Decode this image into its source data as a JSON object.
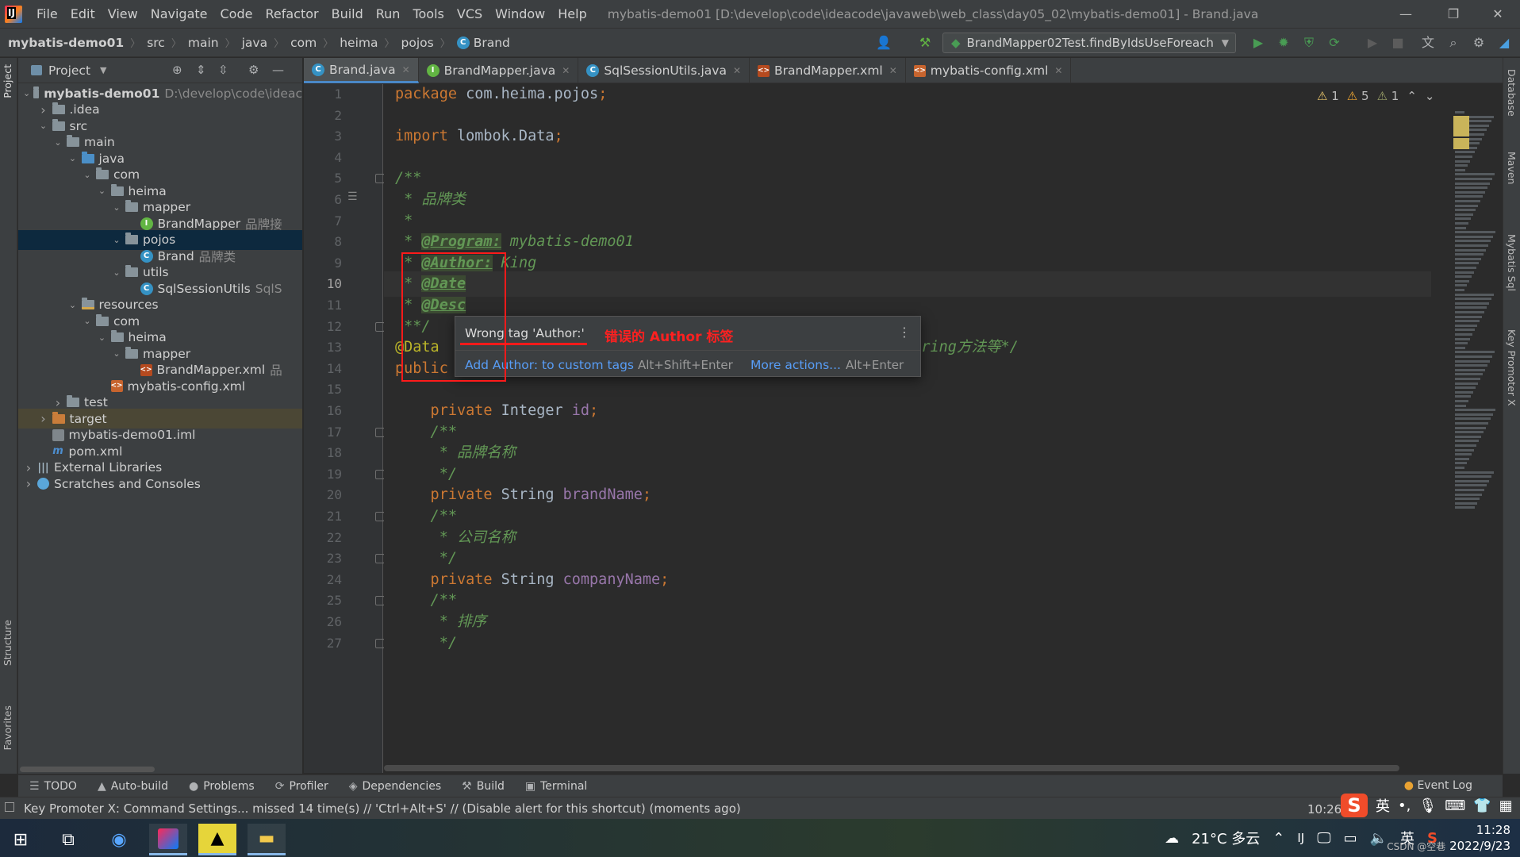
{
  "window": {
    "title": "mybatis-demo01 [D:\\develop\\code\\ideacode\\javaweb\\web_class\\day05_02\\mybatis-demo01] - Brand.java",
    "minimize": "—",
    "maximize": "❐",
    "close": "✕"
  },
  "menu": [
    "File",
    "Edit",
    "View",
    "Navigate",
    "Code",
    "Refactor",
    "Build",
    "Run",
    "Tools",
    "VCS",
    "Window",
    "Help"
  ],
  "breadcrumbs": [
    "mybatis-demo01",
    "src",
    "main",
    "java",
    "com",
    "heima",
    "pojos",
    "Brand"
  ],
  "run_config": "BrandMapper02Test.findByIdsUseForeach",
  "left_strip": {
    "project": "Project",
    "structure": "Structure",
    "favorites": "Favorites"
  },
  "right_strip": {
    "database": "Database",
    "maven": "Maven",
    "mybatis": "Mybatis Sql",
    "key_promoter": "Key Promoter X"
  },
  "project": {
    "header": "Project",
    "tree": [
      {
        "label": "mybatis-demo01",
        "hint": "D:\\develop\\code\\ideac",
        "icon": "module",
        "depth": 0,
        "open": true,
        "bold": true
      },
      {
        "label": ".idea",
        "icon": "folder",
        "depth": 1,
        "open": false
      },
      {
        "label": "src",
        "icon": "folder",
        "depth": 1,
        "open": true
      },
      {
        "label": "main",
        "icon": "folder",
        "depth": 2,
        "open": true
      },
      {
        "label": "java",
        "icon": "folder-blue",
        "depth": 3,
        "open": true
      },
      {
        "label": "com",
        "icon": "package",
        "depth": 4,
        "open": true
      },
      {
        "label": "heima",
        "icon": "package",
        "depth": 5,
        "open": true
      },
      {
        "label": "mapper",
        "icon": "package",
        "depth": 6,
        "open": true
      },
      {
        "label": "BrandMapper",
        "hint": "品牌接",
        "icon": "interface",
        "depth": 7
      },
      {
        "label": "pojos",
        "icon": "package",
        "depth": 6,
        "open": true,
        "selected": true
      },
      {
        "label": "Brand",
        "hint": "品牌类",
        "icon": "class",
        "depth": 7
      },
      {
        "label": "utils",
        "icon": "package",
        "depth": 6,
        "open": true
      },
      {
        "label": "SqlSessionUtils",
        "hint": "SqlS",
        "icon": "class",
        "depth": 7
      },
      {
        "label": "resources",
        "icon": "folder-res",
        "depth": 3,
        "open": true
      },
      {
        "label": "com",
        "icon": "folder",
        "depth": 4,
        "open": true
      },
      {
        "label": "heima",
        "icon": "folder",
        "depth": 5,
        "open": true
      },
      {
        "label": "mapper",
        "icon": "folder",
        "depth": 6,
        "open": true
      },
      {
        "label": "BrandMapper.xml",
        "hint": "品",
        "icon": "xml",
        "depth": 7
      },
      {
        "label": "mybatis-config.xml",
        "icon": "config",
        "depth": 5
      },
      {
        "label": "test",
        "icon": "folder",
        "depth": 2,
        "open": false
      },
      {
        "label": "target",
        "icon": "folder-orange",
        "depth": 1,
        "open": false,
        "excluded": true
      },
      {
        "label": "mybatis-demo01.iml",
        "icon": "iml",
        "depth": 1
      },
      {
        "label": "pom.xml",
        "icon": "maven",
        "depth": 1
      },
      {
        "label": "External Libraries",
        "icon": "library",
        "depth": 0,
        "open": false
      },
      {
        "label": "Scratches and Consoles",
        "icon": "scratch",
        "depth": 0,
        "open": false
      }
    ]
  },
  "tabs": [
    {
      "label": "Brand.java",
      "icon": "class",
      "active": true
    },
    {
      "label": "BrandMapper.java",
      "icon": "interface"
    },
    {
      "label": "SqlSessionUtils.java",
      "icon": "class"
    },
    {
      "label": "BrandMapper.xml",
      "icon": "xml"
    },
    {
      "label": "mybatis-config.xml",
      "icon": "config"
    }
  ],
  "inspections": {
    "weak_warnings": "1",
    "warnings": "5",
    "typos": "1"
  },
  "current_line": 10,
  "code": [
    [
      {
        "t": "package ",
        "c": "kw"
      },
      {
        "t": "com.heima.pojos",
        "c": ""
      },
      {
        "t": ";",
        "c": "kw"
      }
    ],
    [],
    [
      {
        "t": "import ",
        "c": "kw"
      },
      {
        "t": "lombok.Data",
        "c": ""
      },
      {
        "t": ";",
        "c": "kw"
      }
    ],
    [],
    [
      {
        "t": "/**",
        "c": "doc"
      }
    ],
    [
      {
        "t": " * 品牌类",
        "c": "doc"
      }
    ],
    [
      {
        "t": " *",
        "c": "doc"
      }
    ],
    [
      {
        "t": " * ",
        "c": "doc"
      },
      {
        "t": "@Program:",
        "c": "tag"
      },
      {
        "t": " mybatis-demo01",
        "c": "doc"
      }
    ],
    [
      {
        "t": " * ",
        "c": "doc"
      },
      {
        "t": "@Author:",
        "c": "tag"
      },
      {
        "t": " King",
        "c": "doc"
      }
    ],
    [
      {
        "t": " * ",
        "c": "doc"
      },
      {
        "t": "@Date",
        "c": "tag"
      }
    ],
    [
      {
        "t": " * ",
        "c": "doc"
      },
      {
        "t": "@Desc",
        "c": "tag"
      }
    ],
    [
      {
        "t": " **/",
        "c": "doc"
      }
    ],
    [
      {
        "t": "@Data",
        "c": "ann"
      },
      {
        "t": "   ",
        "c": ""
      },
      {
        "t": "/**",
        "c": "doc cmt-hl"
      },
      {
        "t": "能够帮助我们自动生成getter/setter方法，无参构造器，toString方法等*/",
        "c": "doc"
      }
    ],
    [
      {
        "t": "public class ",
        "c": "kw"
      },
      {
        "t": "Brand",
        "c": ""
      },
      {
        "t": " {",
        "c": ""
      }
    ],
    [],
    [
      {
        "t": "    private ",
        "c": "kw"
      },
      {
        "t": "Integer ",
        "c": ""
      },
      {
        "t": "id",
        "c": "field"
      },
      {
        "t": ";",
        "c": "kw"
      }
    ],
    [
      {
        "t": "    /**",
        "c": "doc"
      }
    ],
    [
      {
        "t": "     * 品牌名称",
        "c": "doc"
      }
    ],
    [
      {
        "t": "     */",
        "c": "doc"
      }
    ],
    [
      {
        "t": "    private ",
        "c": "kw"
      },
      {
        "t": "String ",
        "c": ""
      },
      {
        "t": "brandName",
        "c": "field"
      },
      {
        "t": ";",
        "c": "kw"
      }
    ],
    [
      {
        "t": "    /**",
        "c": "doc"
      }
    ],
    [
      {
        "t": "     * 公司名称",
        "c": "doc"
      }
    ],
    [
      {
        "t": "     */",
        "c": "doc"
      }
    ],
    [
      {
        "t": "    private ",
        "c": "kw"
      },
      {
        "t": "String ",
        "c": ""
      },
      {
        "t": "companyName",
        "c": "field"
      },
      {
        "t": ";",
        "c": "kw"
      }
    ],
    [
      {
        "t": "    /**",
        "c": "doc"
      }
    ],
    [
      {
        "t": "     * 排序",
        "c": "doc"
      }
    ],
    [
      {
        "t": "     */",
        "c": "doc"
      }
    ]
  ],
  "popup": {
    "message": "Wrong tag 'Author:'",
    "action": "Add Author: to custom tags",
    "action_key": "Alt+Shift+Enter",
    "more": "More actions...",
    "more_key": "Alt+Enter",
    "menu": "⋮"
  },
  "annotation_note": "错误的 Author 标签",
  "bottom_tools": [
    {
      "icon": "☰",
      "label": "TODO"
    },
    {
      "icon": "▲",
      "label": "Auto-build"
    },
    {
      "icon": "●",
      "label": "Problems"
    },
    {
      "icon": "⟳",
      "label": "Profiler"
    },
    {
      "icon": "◈",
      "label": "Dependencies"
    },
    {
      "icon": "⚒",
      "label": "Build"
    },
    {
      "icon": "▣",
      "label": "Terminal"
    }
  ],
  "event_log": "Event Log",
  "status": {
    "message": "Key Promoter X: Command Settings... missed 14 time(s) // 'Ctrl+Alt+S' // (Disable alert for this shortcut) (moments ago)",
    "position": "10:26"
  },
  "ime": {
    "logo": "S",
    "lang": "英",
    "punct": "•,"
  },
  "taskbar": {
    "weather": "21°C 多云",
    "ime_lang": "英",
    "time": "11:28",
    "date": "2022/9/23",
    "watermark": "CSDN @空巷"
  }
}
